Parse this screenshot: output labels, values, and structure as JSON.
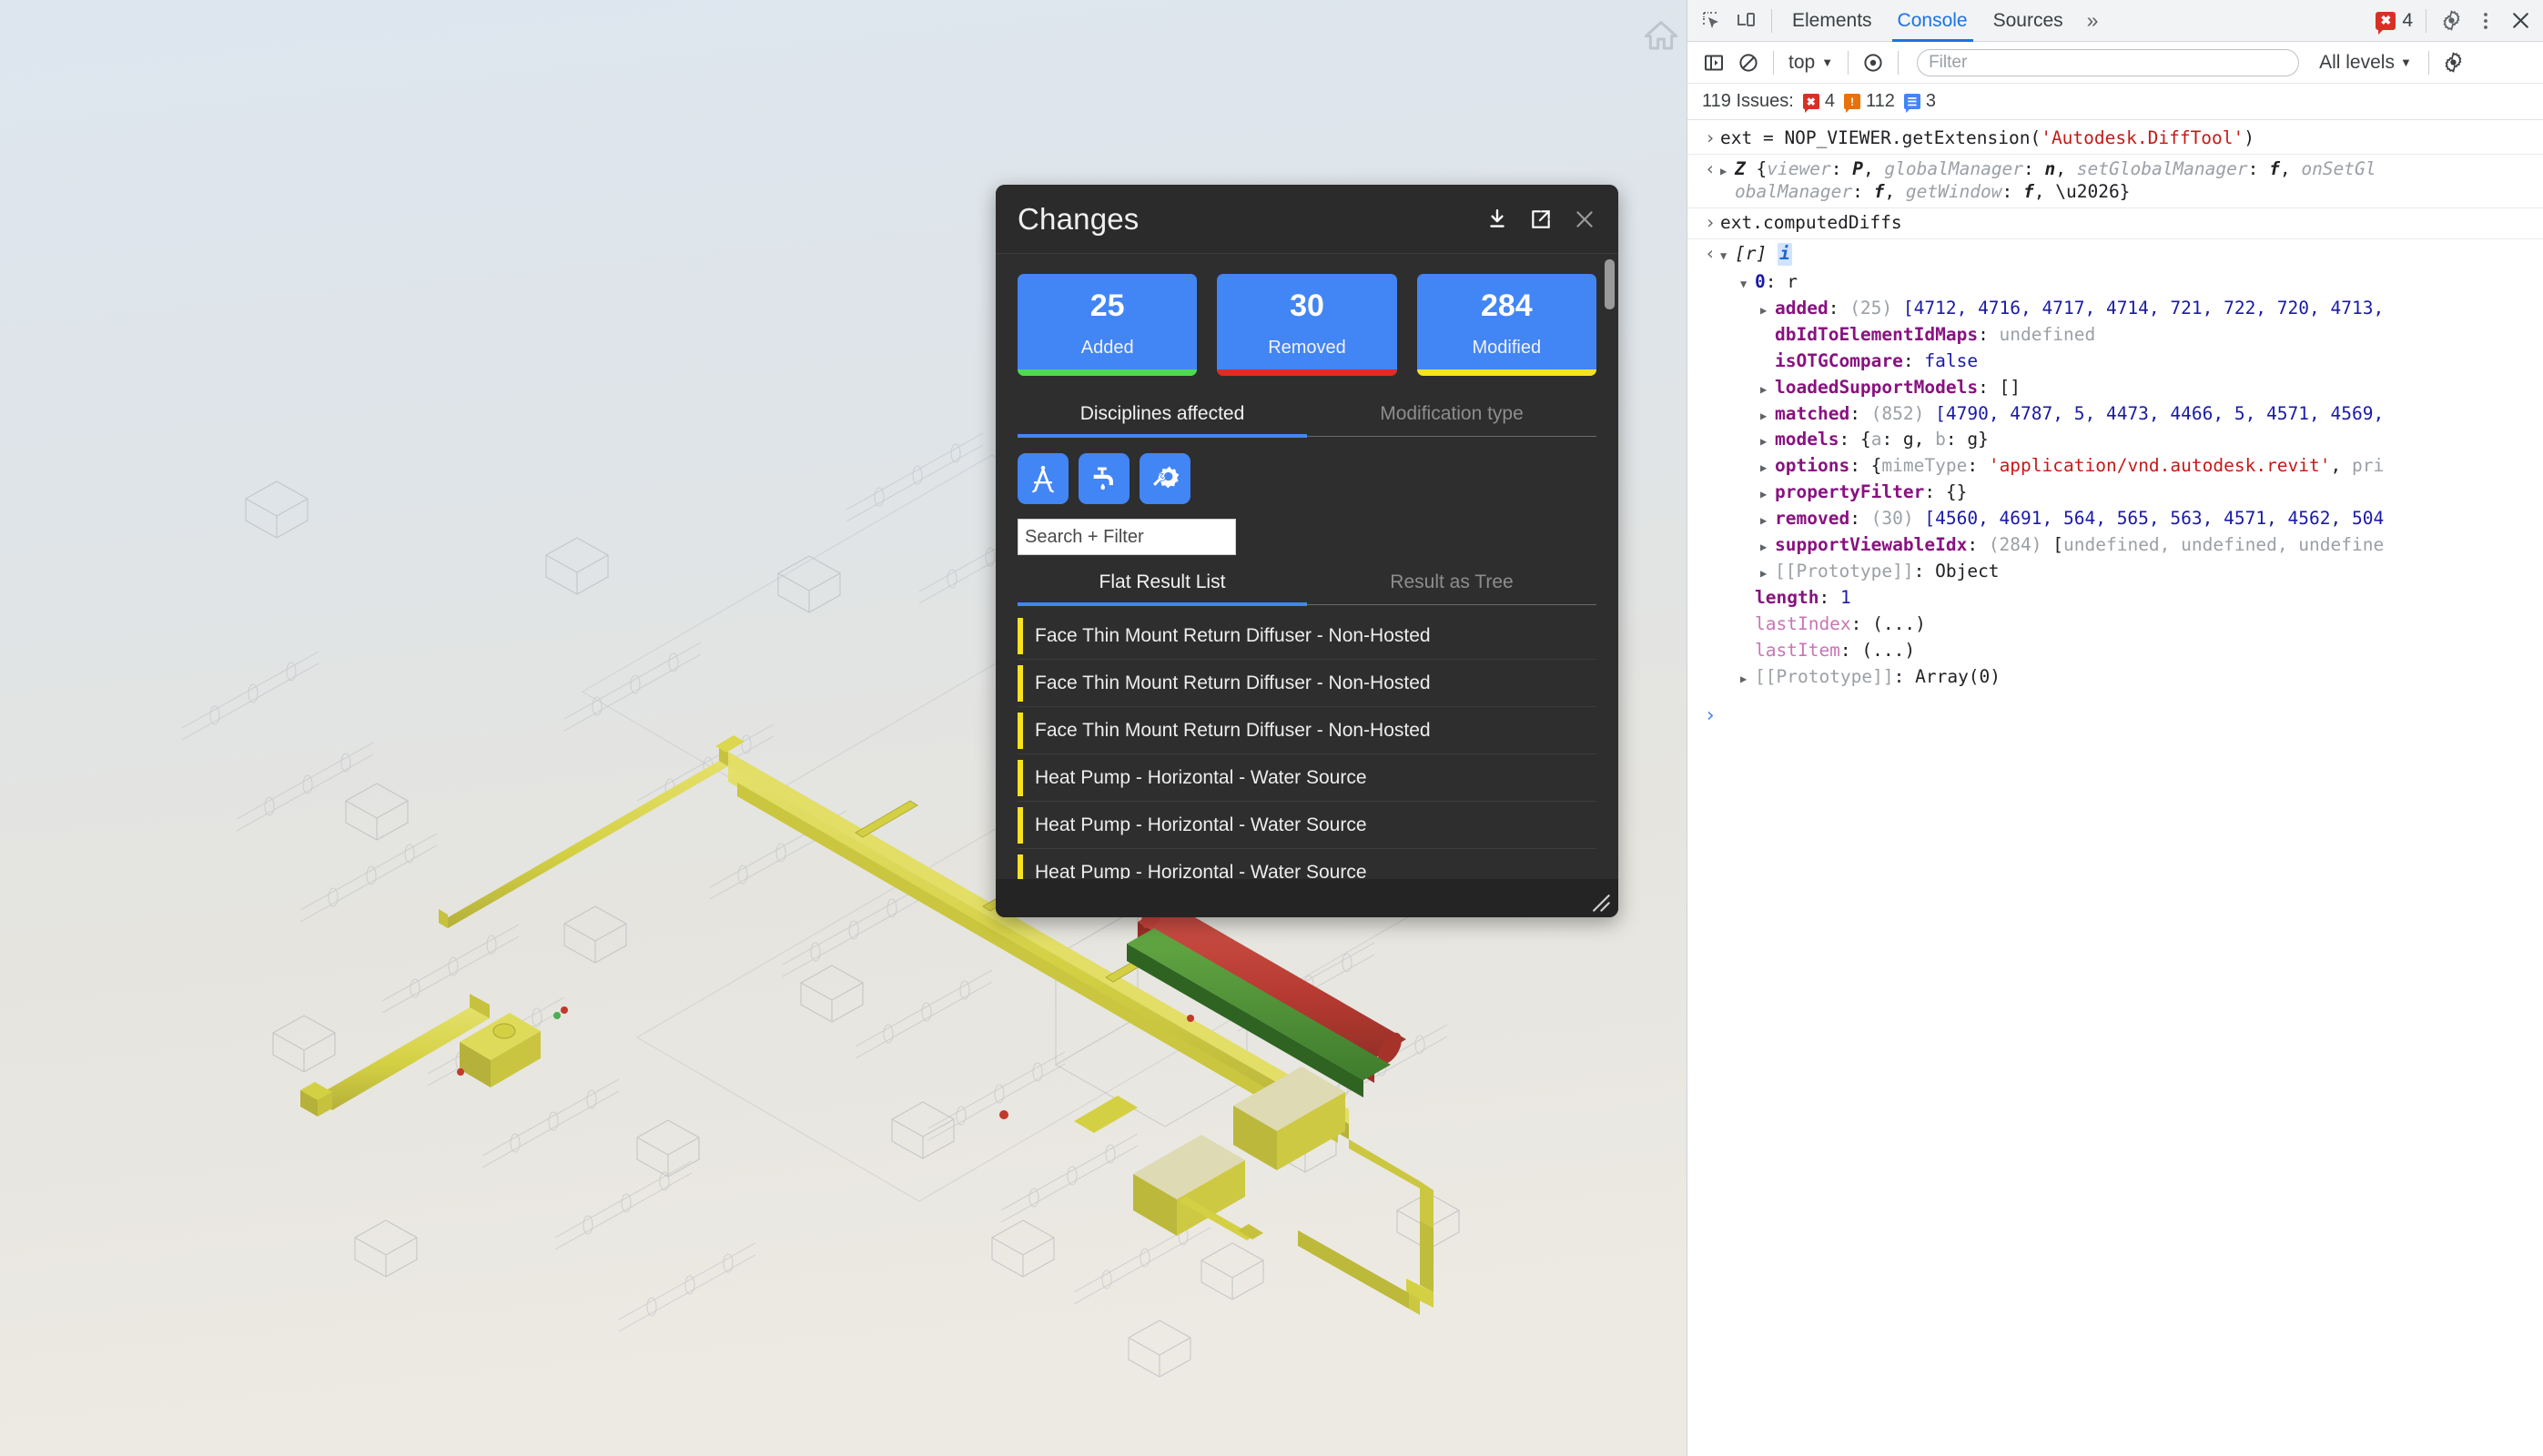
{
  "viewer": {
    "home_icon": "home-icon",
    "background_top": "#dde6ef",
    "background_bottom": "#eceae3",
    "model_colors": {
      "modified": "#d8d44a",
      "removed": "#c0392b",
      "added": "#4caf50",
      "neutral": "#d9d9d9"
    }
  },
  "changes_panel": {
    "title": "Changes",
    "actions": [
      {
        "name": "download-icon",
        "label": "Download"
      },
      {
        "name": "popout-icon",
        "label": "Open in new window"
      },
      {
        "name": "close-icon",
        "label": "Close"
      }
    ],
    "summary": [
      {
        "count": "25",
        "label": "Added",
        "bar_color": "#4ddb4d",
        "tile_color": "#4285f4"
      },
      {
        "count": "30",
        "label": "Removed",
        "bar_color": "#e02b20",
        "tile_color": "#4285f4"
      },
      {
        "count": "284",
        "label": "Modified",
        "bar_color": "#f7e220",
        "tile_color": "#4285f4"
      }
    ],
    "filter_tabs": [
      {
        "label": "Disciplines affected",
        "active": true
      },
      {
        "label": "Modification type",
        "active": false
      }
    ],
    "disciplines": [
      {
        "name": "architecture-compass-icon",
        "label": "Architecture",
        "active": true
      },
      {
        "name": "plumbing-faucet-icon",
        "label": "Plumbing",
        "active": true
      },
      {
        "name": "mechanical-gear-wrench-icon",
        "label": "Mechanical",
        "active": true
      }
    ],
    "search": {
      "placeholder": "Search + Filter",
      "value": ""
    },
    "view_tabs": [
      {
        "label": "Flat Result List",
        "active": true
      },
      {
        "label": "Result as Tree",
        "active": false
      }
    ],
    "results": [
      {
        "label": "Face Thin Mount Return Diffuser - Non-Hosted",
        "status_color": "#f7e220"
      },
      {
        "label": "Face Thin Mount Return Diffuser - Non-Hosted",
        "status_color": "#f7e220"
      },
      {
        "label": "Face Thin Mount Return Diffuser - Non-Hosted",
        "status_color": "#f7e220"
      },
      {
        "label": "Heat Pump - Horizontal - Water Source",
        "status_color": "#f7e220"
      },
      {
        "label": "Heat Pump - Horizontal - Water Source",
        "status_color": "#f7e220"
      },
      {
        "label": "Heat Pump - Horizontal - Water Source",
        "status_color": "#f7e220"
      }
    ],
    "resize_grip": "resize-grip-icon"
  },
  "devtools": {
    "tabbar": {
      "inspect_icon": "inspect-element-icon",
      "device_icon": "device-toolbar-icon",
      "tabs": [
        {
          "label": "Elements",
          "active": false
        },
        {
          "label": "Console",
          "active": true
        },
        {
          "label": "Sources",
          "active": false
        }
      ],
      "more_tabs": "»",
      "error_count": "4",
      "settings_icon": "gear-icon",
      "menu_icon": "kebab-menu-icon",
      "close_icon": "close-icon"
    },
    "toolbar": {
      "sidebar_icon": "console-sidebar-icon",
      "clear_icon": "clear-console-icon",
      "context": "top",
      "eye_icon": "live-expression-icon",
      "filter_placeholder": "Filter",
      "filter_value": "",
      "levels": "All levels",
      "settings_icon": "gear-icon"
    },
    "issues": {
      "summary": "119 Issues:",
      "errors": "4",
      "warnings": "112",
      "info": "3"
    },
    "console_lines": [
      {
        "kind": "input",
        "indent": 0,
        "arrow": "none",
        "text": "ext = NOP_VIEWER.getExtension('Autodesk.DiffTool')"
      },
      {
        "kind": "output",
        "indent": 0,
        "arrow": "closed",
        "text": "Z {viewer: P, globalManager: n, setGlobalManager: f, onSetGl"
      },
      {
        "kind": "cont",
        "indent": 0,
        "arrow": "none",
        "text": "obalManager: f, getWindow: f, …}"
      },
      {
        "kind": "input",
        "indent": 0,
        "arrow": "none",
        "text": "ext.computedDiffs"
      },
      {
        "kind": "output",
        "indent": 0,
        "arrow": "open",
        "text": "[r]  i"
      },
      {
        "kind": "tree",
        "indent": 1,
        "arrow": "open",
        "text": "0: r"
      },
      {
        "kind": "tree",
        "indent": 2,
        "arrow": "closed",
        "text": "added: (25) [4712, 4716, 4717, 4714, 721, 722, 720, 4713,"
      },
      {
        "kind": "tree",
        "indent": 2,
        "arrow": "none",
        "text": "dbIdToElementIdMaps: undefined"
      },
      {
        "kind": "tree",
        "indent": 2,
        "arrow": "none",
        "text": "isOTGCompare: false"
      },
      {
        "kind": "tree",
        "indent": 2,
        "arrow": "closed",
        "text": "loadedSupportModels: []"
      },
      {
        "kind": "tree",
        "indent": 2,
        "arrow": "closed",
        "text": "matched: (852) [4790, 4787, 5, 4473, 4466, 5, 4571, 4569,"
      },
      {
        "kind": "tree",
        "indent": 2,
        "arrow": "closed",
        "text": "models: {a: g, b: g}"
      },
      {
        "kind": "tree",
        "indent": 2,
        "arrow": "closed",
        "text": "options: {mimeType: 'application/vnd.autodesk.revit', pri"
      },
      {
        "kind": "tree",
        "indent": 2,
        "arrow": "closed",
        "text": "propertyFilter: {}"
      },
      {
        "kind": "tree",
        "indent": 2,
        "arrow": "closed",
        "text": "removed: (30) [4560, 4691, 564, 565, 563, 4571, 4562, 504"
      },
      {
        "kind": "tree",
        "indent": 2,
        "arrow": "closed",
        "text": "supportViewableIdx: (284) [undefined, undefined, undefine"
      },
      {
        "kind": "tree",
        "indent": 2,
        "arrow": "closed",
        "text": "[[Prototype]]: Object"
      },
      {
        "kind": "tree",
        "indent": 1,
        "arrow": "none",
        "text": "length: 1"
      },
      {
        "kind": "tree",
        "indent": 1,
        "arrow": "none",
        "text": "lastIndex: (...)"
      },
      {
        "kind": "tree",
        "indent": 1,
        "arrow": "none",
        "text": "lastItem: (...)"
      },
      {
        "kind": "tree",
        "indent": 1,
        "arrow": "closed",
        "text": "[[Prototype]]: Array(0)"
      }
    ],
    "prompt_symbol": ">"
  }
}
